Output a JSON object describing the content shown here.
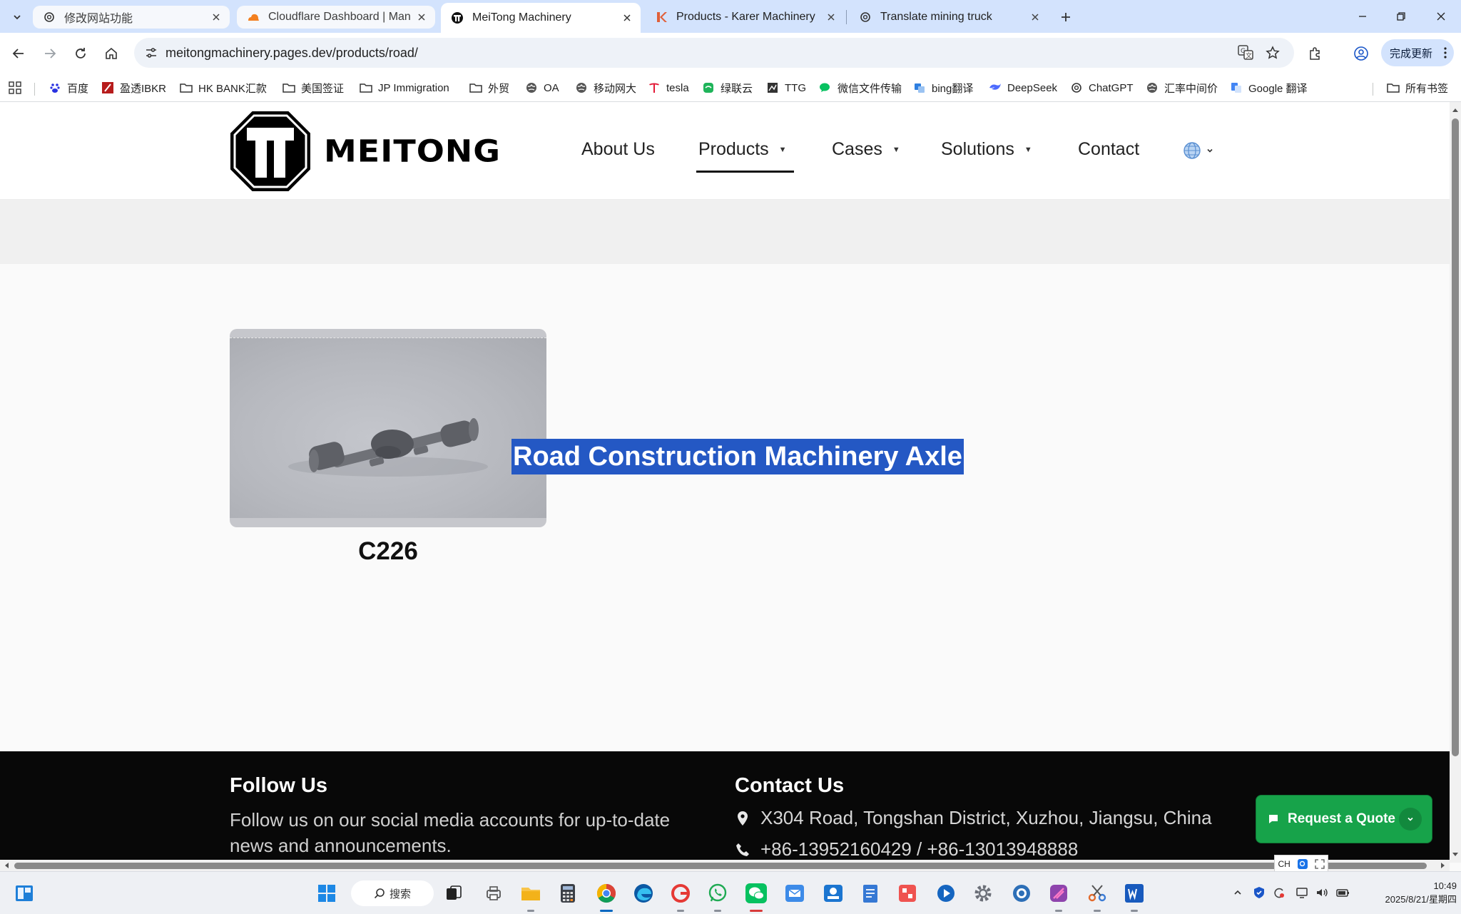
{
  "tabs": [
    {
      "title": "修改网站功能",
      "favicon": "chatgpt-icon",
      "state": "inactive"
    },
    {
      "title": "Cloudflare Dashboard | Mana",
      "favicon": "cloudflare-icon",
      "state": "inactive"
    },
    {
      "title": "MeiTong Machinery",
      "favicon": "meitong-icon",
      "state": "active"
    },
    {
      "title": "Products - Karer Machinery",
      "favicon": "karer-icon",
      "state": "inactive"
    },
    {
      "title": "Translate mining truck",
      "favicon": "chatgpt-icon",
      "state": "inactive"
    }
  ],
  "toolbar": {
    "url": "meitongmachinery.pages.dev/products/road/",
    "update_label": "完成更新"
  },
  "bookmarks": [
    {
      "label": "百度",
      "icon": "baidu-icon"
    },
    {
      "label": "盈透IBKR",
      "icon": "ibkr-icon"
    },
    {
      "label": "HK BANK汇款",
      "icon": "folder-icon"
    },
    {
      "label": "美国签证",
      "icon": "folder-icon"
    },
    {
      "label": "JP Immigration",
      "icon": "folder-icon"
    },
    {
      "label": "外贸",
      "icon": "folder-icon"
    },
    {
      "label": "OA",
      "icon": "globe-icon"
    },
    {
      "label": "移动网大",
      "icon": "globe-icon"
    },
    {
      "label": "tesla",
      "icon": "tesla-icon"
    },
    {
      "label": "绿联云",
      "icon": "ugreen-icon"
    },
    {
      "label": "TTG",
      "icon": "ttg-icon"
    },
    {
      "label": "微信文件传输",
      "icon": "wechat-icon"
    },
    {
      "label": "bing翻译",
      "icon": "bing-translate-icon"
    },
    {
      "label": "DeepSeek",
      "icon": "deepseek-icon"
    },
    {
      "label": "ChatGPT",
      "icon": "chatgpt-icon"
    },
    {
      "label": "汇率中间价",
      "icon": "globe-icon"
    },
    {
      "label": "Google 翻译",
      "icon": "google-translate-icon"
    },
    {
      "label": "所有书签",
      "icon": "folder-icon"
    }
  ],
  "site": {
    "logo_text": "MEITONG",
    "nav": [
      {
        "label": "About Us",
        "dropdown": false
      },
      {
        "label": "Products",
        "dropdown": true,
        "active": true
      },
      {
        "label": "Cases",
        "dropdown": true
      },
      {
        "label": "Solutions",
        "dropdown": true
      },
      {
        "label": "Contact",
        "dropdown": false
      }
    ],
    "selected_text": "Road Construction Machinery Axle",
    "product": {
      "name": "C226",
      "image": "axle-image"
    },
    "footer": {
      "follow_heading": "Follow Us",
      "follow_text": "Follow us on our social media accounts for up-to-date news and announcements.",
      "contact_heading": "Contact Us",
      "address": "X304 Road, Tongshan District, Xuzhou, Jiangsu, China",
      "phone": "+86-13952160429 / +86-13013948888"
    },
    "quote_button": "Request a Quote"
  },
  "ime": {
    "label": "CH"
  },
  "taskbar": {
    "search_label": "搜索",
    "time": "10:49",
    "date": "2025/8/21/星期四"
  },
  "colors": {
    "tabstrip": "#d3e3fd",
    "selection": "#2458c4",
    "quote_green": "#17a34a",
    "footer_bg": "#080808"
  }
}
